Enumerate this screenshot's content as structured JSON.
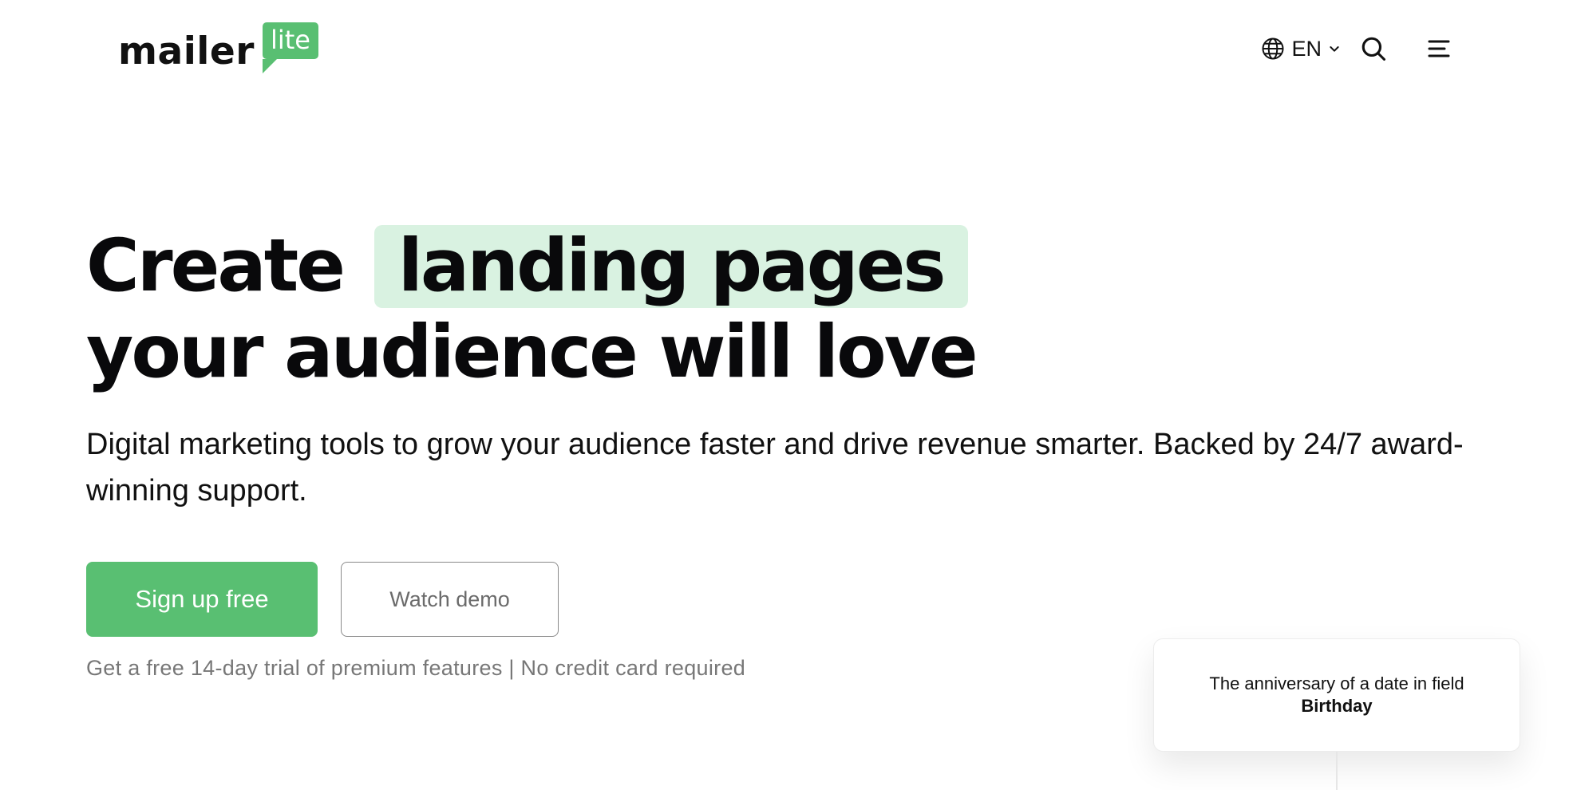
{
  "brand": {
    "logo_word": "mailer",
    "logo_badge": "lite",
    "accent_color": "#59bf72",
    "highlight_color": "#d9f2e1"
  },
  "header": {
    "language": {
      "code": "EN",
      "icon": "globe-icon",
      "caret_icon": "chevron-down-icon"
    },
    "search_icon": "search-icon",
    "menu_icon": "hamburger-menu-icon"
  },
  "hero": {
    "headline_start": "Create",
    "headline_highlight": "landing pages",
    "headline_end": "your audience will love",
    "subtitle": "Digital marketing tools to grow your audience faster and drive revenue smarter. Backed by 24/7 award-winning support.",
    "primary_cta": "Sign up free",
    "secondary_cta": "Watch demo",
    "note": "Get a free 14-day trial of premium features | No credit card required"
  },
  "card": {
    "text_prefix": "The anniversary of a date in field ",
    "text_bold": "Birthday"
  }
}
